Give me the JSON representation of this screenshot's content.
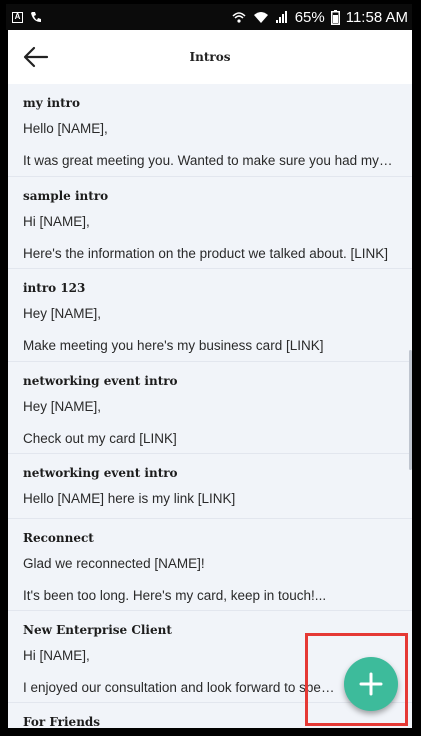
{
  "status_bar": {
    "battery": "65%",
    "time": "11:58 AM",
    "icons": [
      "notification-icon",
      "wifi-call-icon",
      "hotspot-icon",
      "wifi-icon",
      "signal-icon",
      "battery-icon"
    ]
  },
  "app_bar": {
    "back_icon": "arrow-left-icon",
    "title": "Intros"
  },
  "intros": [
    {
      "title": "my intro",
      "lines": [
        "Hello [NAME],",
        "It was great meeting you. Wanted to make sure you had my info..."
      ]
    },
    {
      "title": "sample intro",
      "lines": [
        "Hi [NAME],",
        "Here's the information on the product we talked about. [LINK]"
      ]
    },
    {
      "title": "intro 123",
      "lines": [
        "Hey [NAME],",
        "Make meeting you here's my business card [LINK]"
      ]
    },
    {
      "title": "networking event intro",
      "lines": [
        "Hey [NAME],",
        "Check out my card [LINK]"
      ]
    },
    {
      "title": "networking event intro",
      "lines": [
        "Hello [NAME] here is my link [LINK]"
      ]
    },
    {
      "title": "Reconnect",
      "lines": [
        "Glad we reconnected [NAME]!",
        "It's been too long. Here's my card, keep in touch!..."
      ]
    },
    {
      "title": "New Enterprise Client",
      "lines": [
        "Hi [NAME],",
        "I enjoyed our consultation and look forward to speaking"
      ]
    },
    {
      "title": "For Friends",
      "lines": []
    }
  ],
  "fab": {
    "icon": "plus-icon"
  },
  "colors": {
    "background": "#f1f4f9",
    "fab": "#3dbb9b",
    "highlight": "#e53935"
  }
}
